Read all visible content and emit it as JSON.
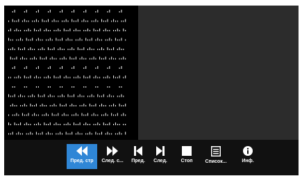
{
  "toolbar": {
    "buttons": [
      {
        "label": "Пред. стр",
        "icon": "fast-backward-icon",
        "active": true
      },
      {
        "label": "След. с...",
        "icon": "fast-forward-icon",
        "active": false
      },
      {
        "label": "Пред.",
        "icon": "skip-previous-icon",
        "active": false
      },
      {
        "label": "След.",
        "icon": "skip-next-icon",
        "active": false
      },
      {
        "label": "Стоп",
        "icon": "stop-icon",
        "active": false
      },
      {
        "label": "Список...",
        "icon": "list-icon",
        "active": false
      },
      {
        "label": "Инф.",
        "icon": "info-icon",
        "active": false
      }
    ]
  },
  "colors": {
    "viewer_bg": "#2c2c2c",
    "page_bg": "#000000",
    "toolbar_bg": "#111111",
    "active_button": "#2f86d6",
    "dots": "#ffffff"
  }
}
